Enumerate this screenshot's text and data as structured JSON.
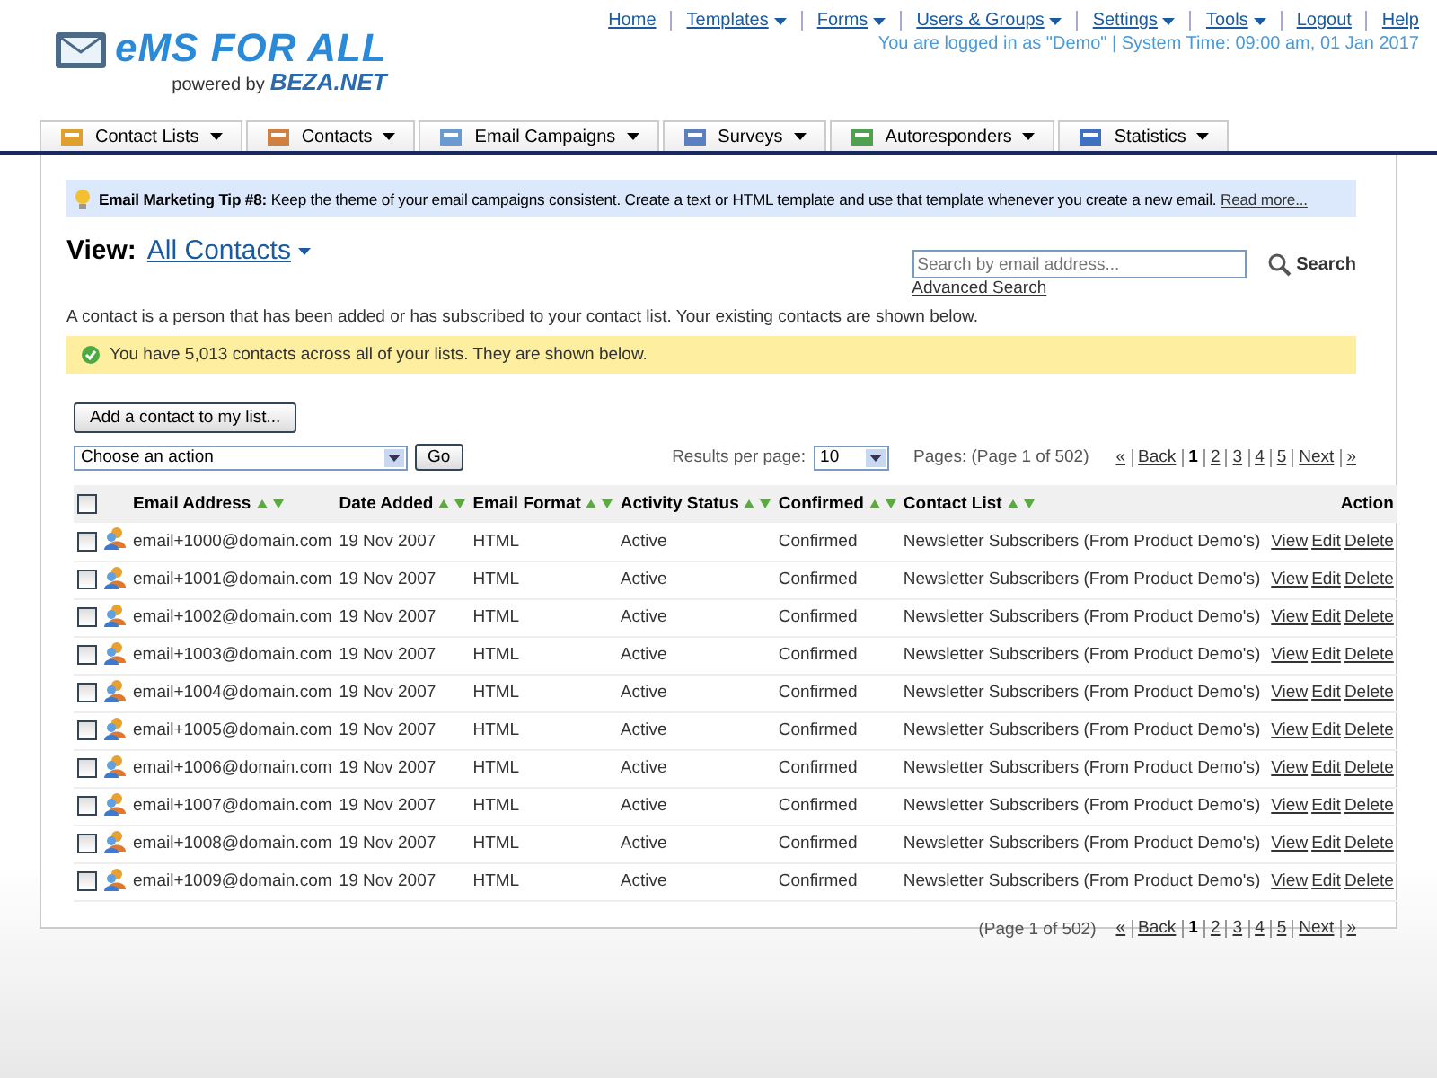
{
  "logo": {
    "title": "eMS FOR ALL",
    "powered": "powered by",
    "brand": "BEZA.NET"
  },
  "top_nav": [
    {
      "label": "Home",
      "dropdown": false
    },
    {
      "label": "Templates",
      "dropdown": true
    },
    {
      "label": "Forms",
      "dropdown": true
    },
    {
      "label": "Users & Groups",
      "dropdown": true
    },
    {
      "label": "Settings",
      "dropdown": true
    },
    {
      "label": "Tools",
      "dropdown": true
    },
    {
      "label": "Logout",
      "dropdown": false
    },
    {
      "label": "Help",
      "dropdown": false
    }
  ],
  "login_status": "You are logged in as \"Demo\" | System Time: 09:00 am, 01 Jan 2017",
  "tabs": [
    {
      "label": "Contact Lists",
      "selected": false
    },
    {
      "label": "Contacts",
      "selected": false
    },
    {
      "label": "Email Campaigns",
      "selected": false
    },
    {
      "label": "Surveys",
      "selected": false
    },
    {
      "label": "Autoresponders",
      "selected": false
    },
    {
      "label": "Statistics",
      "selected": false
    }
  ],
  "tip": {
    "title": "Email Marketing Tip #8:",
    "text": "Keep the theme of your email campaigns consistent. Create a text or HTML template and use that template whenever you create a new email.",
    "link": "Read more..."
  },
  "view": {
    "label": "View:",
    "value": "All Contacts"
  },
  "search": {
    "placeholder": "Search by email address...",
    "button": "Search",
    "advanced": "Advanced Search"
  },
  "description": "A contact is a person that has been added or has subscribed to your contact list. Your existing contacts are shown below.",
  "notice": "You have 5,013 contacts across all of your lists. They are shown below.",
  "add_button": "Add a contact to my list...",
  "action_select": {
    "value": "Choose an action"
  },
  "go_button": "Go",
  "results_per_page": {
    "label": "Results per page:",
    "value": "10"
  },
  "pages_label": "Pages: (Page 1 of 502)",
  "pagination": [
    {
      "label": "«",
      "selected": false
    },
    {
      "label": "Back",
      "selected": false
    },
    {
      "label": "1",
      "selected": true
    },
    {
      "label": "2",
      "selected": false
    },
    {
      "label": "3",
      "selected": false
    },
    {
      "label": "4",
      "selected": false
    },
    {
      "label": "5",
      "selected": false
    },
    {
      "label": "Next",
      "selected": false
    },
    {
      "label": "»",
      "selected": false
    }
  ],
  "table": {
    "select_all_checked": false,
    "columns": [
      {
        "label": "Email Address",
        "sortable": true
      },
      {
        "label": "Date Added",
        "sortable": true
      },
      {
        "label": "Email Format",
        "sortable": true
      },
      {
        "label": "Activity Status",
        "sortable": true
      },
      {
        "label": "Confirmed",
        "sortable": true
      },
      {
        "label": "Contact List",
        "sortable": true
      },
      {
        "label": "Action",
        "sortable": false
      }
    ],
    "rows": [
      {
        "checked": false,
        "cells": [
          "email+1000@domain.com",
          "19 Nov 2007",
          "HTML",
          "Active",
          "Confirmed",
          "Newsletter Subscribers (From Product Demo's)"
        ],
        "actions": [
          "View",
          "Edit",
          "Delete"
        ]
      },
      {
        "checked": false,
        "cells": [
          "email+1001@domain.com",
          "19 Nov 2007",
          "HTML",
          "Active",
          "Confirmed",
          "Newsletter Subscribers (From Product Demo's)"
        ],
        "actions": [
          "View",
          "Edit",
          "Delete"
        ]
      },
      {
        "checked": false,
        "cells": [
          "email+1002@domain.com",
          "19 Nov 2007",
          "HTML",
          "Active",
          "Confirmed",
          "Newsletter Subscribers (From Product Demo's)"
        ],
        "actions": [
          "View",
          "Edit",
          "Delete"
        ]
      },
      {
        "checked": false,
        "cells": [
          "email+1003@domain.com",
          "19 Nov 2007",
          "HTML",
          "Active",
          "Confirmed",
          "Newsletter Subscribers (From Product Demo's)"
        ],
        "actions": [
          "View",
          "Edit",
          "Delete"
        ]
      },
      {
        "checked": false,
        "cells": [
          "email+1004@domain.com",
          "19 Nov 2007",
          "HTML",
          "Active",
          "Confirmed",
          "Newsletter Subscribers (From Product Demo's)"
        ],
        "actions": [
          "View",
          "Edit",
          "Delete"
        ]
      },
      {
        "checked": false,
        "cells": [
          "email+1005@domain.com",
          "19 Nov 2007",
          "HTML",
          "Active",
          "Confirmed",
          "Newsletter Subscribers (From Product Demo's)"
        ],
        "actions": [
          "View",
          "Edit",
          "Delete"
        ]
      },
      {
        "checked": false,
        "cells": [
          "email+1006@domain.com",
          "19 Nov 2007",
          "HTML",
          "Active",
          "Confirmed",
          "Newsletter Subscribers (From Product Demo's)"
        ],
        "actions": [
          "View",
          "Edit",
          "Delete"
        ]
      },
      {
        "checked": false,
        "cells": [
          "email+1007@domain.com",
          "19 Nov 2007",
          "HTML",
          "Active",
          "Confirmed",
          "Newsletter Subscribers (From Product Demo's)"
        ],
        "actions": [
          "View",
          "Edit",
          "Delete"
        ]
      },
      {
        "checked": false,
        "cells": [
          "email+1008@domain.com",
          "19 Nov 2007",
          "HTML",
          "Active",
          "Confirmed",
          "Newsletter Subscribers (From Product Demo's)"
        ],
        "actions": [
          "View",
          "Edit",
          "Delete"
        ]
      },
      {
        "checked": false,
        "cells": [
          "email+1009@domain.com",
          "19 Nov 2007",
          "HTML",
          "Active",
          "Confirmed",
          "Newsletter Subscribers (From Product Demo's)"
        ],
        "actions": [
          "View",
          "Edit",
          "Delete"
        ]
      }
    ]
  },
  "bottom_pages_label": "(Page 1 of 502)",
  "bottom_pagination": [
    {
      "label": "«",
      "selected": false
    },
    {
      "label": "Back",
      "selected": false
    },
    {
      "label": "1",
      "selected": true
    },
    {
      "label": "2",
      "selected": false
    },
    {
      "label": "3",
      "selected": false
    },
    {
      "label": "4",
      "selected": false
    },
    {
      "label": "5",
      "selected": false
    },
    {
      "label": "Next",
      "selected": false
    },
    {
      "label": "»",
      "selected": false
    }
  ]
}
